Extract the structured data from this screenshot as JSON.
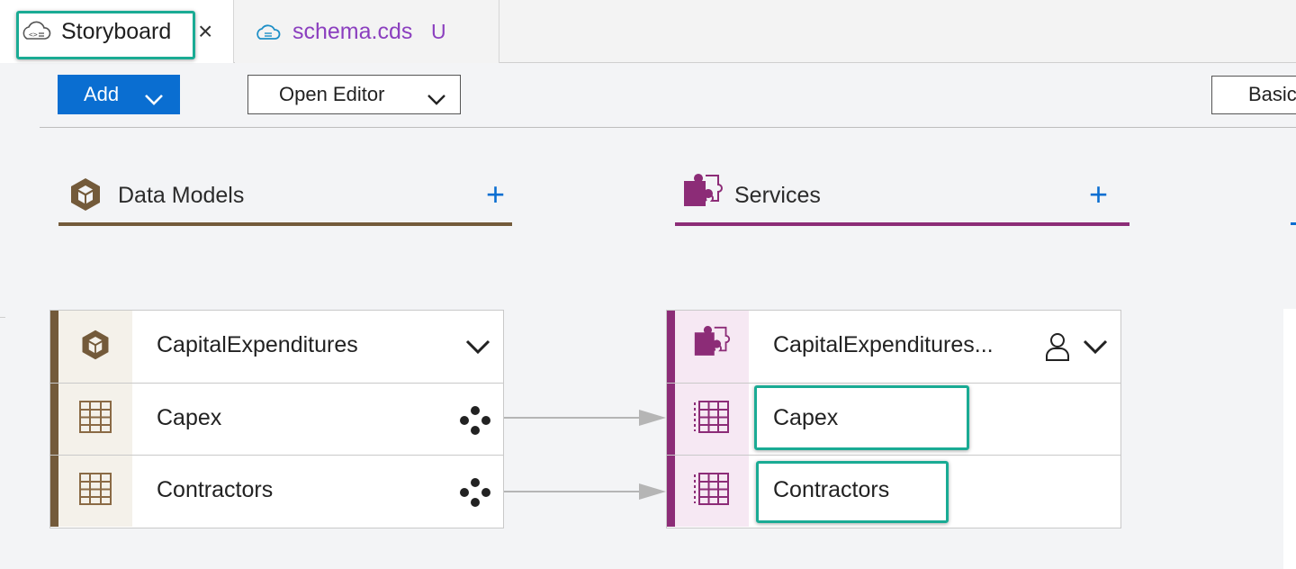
{
  "tabs": [
    {
      "label": "Storyboard",
      "icon": "cloud-storyboard-icon",
      "active": true,
      "close": "×"
    },
    {
      "label": "schema.cds",
      "icon": "cloud-cds-icon",
      "status": "U"
    }
  ],
  "toolbar": {
    "add_label": "Add",
    "open_editor_label": "Open Editor",
    "basic_label": "Basic"
  },
  "columns": {
    "data_models": {
      "title": "Data Models",
      "plus": "+",
      "color": "#735a3a"
    },
    "services": {
      "title": "Services",
      "plus": "+",
      "color": "#8c2c77"
    }
  },
  "data_models_card": {
    "rows": [
      {
        "label": "CapitalExpenditures",
        "icon": "cube-icon",
        "action": "chevron-down-icon"
      },
      {
        "label": "Capex",
        "icon": "table-grid-icon",
        "action": "association-icon"
      },
      {
        "label": "Contractors",
        "icon": "table-grid-icon",
        "action": "association-icon"
      }
    ]
  },
  "services_card": {
    "rows": [
      {
        "label": "CapitalExpenditures...",
        "icon": "puzzle-icon",
        "actions": [
          "user-icon",
          "chevron-down-icon"
        ]
      },
      {
        "label": "Capex",
        "icon": "entity-grid-icon"
      },
      {
        "label": "Contractors",
        "icon": "entity-grid-icon"
      }
    ]
  },
  "colors": {
    "accent_blue": "#0a6ed1",
    "highlight": "#1aab94",
    "tab_purple": "#8b3fbf",
    "model_bg": "#f4f1ea",
    "service_bg": "#f6e8f3"
  }
}
